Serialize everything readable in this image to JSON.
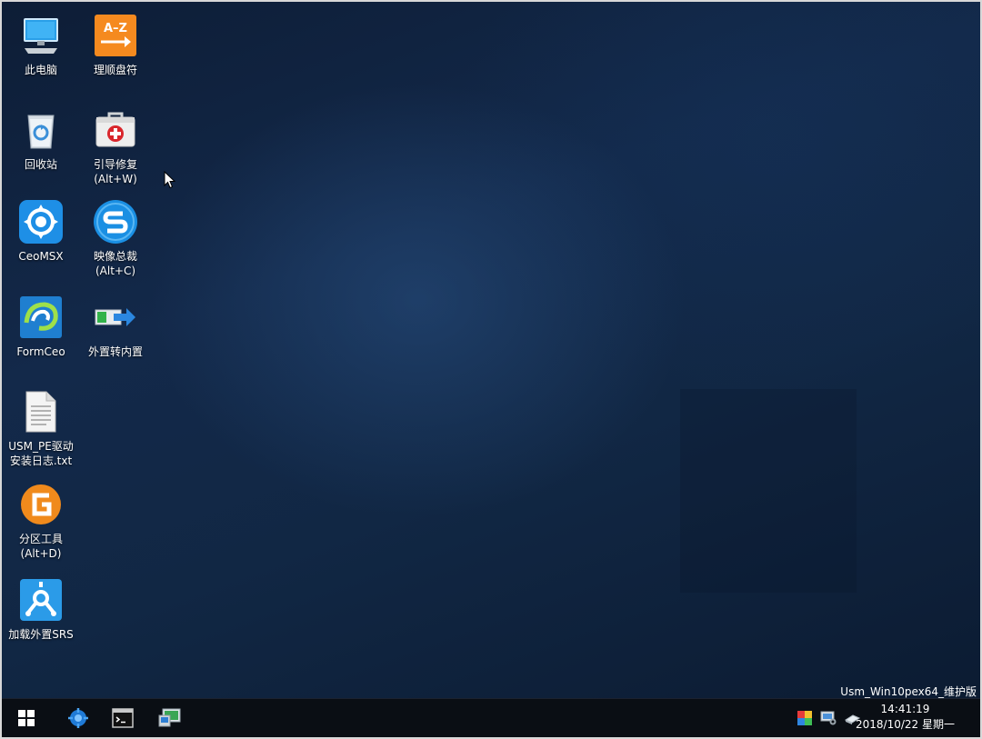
{
  "desktop": {
    "icons": [
      {
        "name": "this-pc",
        "label": "此电脑",
        "icon": "computer-icon"
      },
      {
        "name": "reorder-drive-letters",
        "label": "理顺盘符",
        "icon": "a-z-sort-icon"
      },
      {
        "name": "recycle-bin",
        "label": "回收站",
        "icon": "recycle-bin-icon"
      },
      {
        "name": "boot-repair",
        "label": "引导修复\n(Alt+W)",
        "icon": "first-aid-kit-icon"
      },
      {
        "name": "ceomsx",
        "label": "CeoMSX",
        "icon": "gear-app-icon"
      },
      {
        "name": "image-manager",
        "label": "映像总裁\n(Alt+C)",
        "icon": "s-logo-icon"
      },
      {
        "name": "formceo",
        "label": "FormCeo",
        "icon": "swirl-app-icon"
      },
      {
        "name": "external-to-internal",
        "label": "外置转内置",
        "icon": "convert-arrow-icon"
      },
      {
        "name": "driver-log-txt",
        "label": "USM_PE驱动\n安装日志.txt",
        "icon": "text-file-icon"
      },
      {
        "name": "partition-tool",
        "label": "分区工具\n(Alt+D)",
        "icon": "diskgenius-icon"
      },
      {
        "name": "load-external-srs",
        "label": "加载外置SRS",
        "icon": "firewire-icon"
      }
    ],
    "watermark": "Usm_Win10pex64_维护版"
  },
  "taskbar": {
    "buttons": [
      {
        "name": "start-button",
        "icon": "windows-logo-icon"
      },
      {
        "name": "taskbar-app-1",
        "icon": "network-tool-icon"
      },
      {
        "name": "taskbar-app-2",
        "icon": "command-prompt-icon"
      },
      {
        "name": "taskbar-app-3",
        "icon": "system-monitor-icon"
      }
    ],
    "tray": [
      {
        "name": "tray-color-icon",
        "icon": "color-grid-icon"
      },
      {
        "name": "tray-settings-icon",
        "icon": "device-settings-icon"
      },
      {
        "name": "tray-drive-icon",
        "icon": "usb-drive-icon"
      }
    ],
    "clock": {
      "time": "14:41:19",
      "date": "2018/10/22 星期一"
    }
  }
}
